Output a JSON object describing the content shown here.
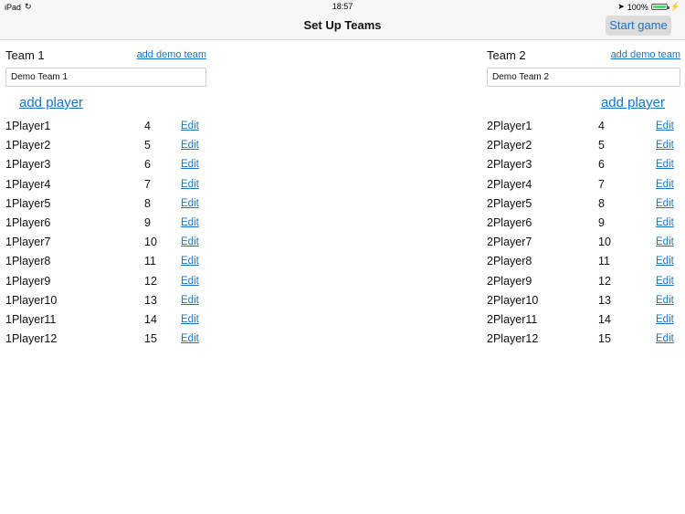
{
  "status": {
    "device": "iPad",
    "time": "18:57",
    "battery": "100%"
  },
  "nav": {
    "title": "Set Up Teams",
    "start_label": "Start game"
  },
  "team1": {
    "label": "Team 1",
    "demo_label": "add demo team",
    "name_value": "Demo Team 1",
    "add_player_label": "add player",
    "players": [
      {
        "name": "1Player1",
        "number": "4",
        "edit": "Edit"
      },
      {
        "name": "1Player2",
        "number": "5",
        "edit": "Edit"
      },
      {
        "name": "1Player3",
        "number": "6",
        "edit": "Edit"
      },
      {
        "name": "1Player4",
        "number": "7",
        "edit": "Edit"
      },
      {
        "name": "1Player5",
        "number": "8",
        "edit": "Edit"
      },
      {
        "name": "1Player6",
        "number": "9",
        "edit": "Edit"
      },
      {
        "name": "1Player7",
        "number": "10",
        "edit": "Edit"
      },
      {
        "name": "1Player8",
        "number": "11",
        "edit": "Edit"
      },
      {
        "name": "1Player9",
        "number": "12",
        "edit": "Edit"
      },
      {
        "name": "1Player10",
        "number": "13",
        "edit": "Edit"
      },
      {
        "name": "1Player11",
        "number": "14",
        "edit": "Edit"
      },
      {
        "name": "1Player12",
        "number": "15",
        "edit": "Edit"
      }
    ]
  },
  "team2": {
    "label": "Team 2",
    "demo_label": "add demo team",
    "name_value": "Demo Team 2",
    "add_player_label": "add player",
    "players": [
      {
        "name": "2Player1",
        "number": "4",
        "edit": "Edit"
      },
      {
        "name": "2Player2",
        "number": "5",
        "edit": "Edit"
      },
      {
        "name": "2Player3",
        "number": "6",
        "edit": "Edit"
      },
      {
        "name": "2Player4",
        "number": "7",
        "edit": "Edit"
      },
      {
        "name": "2Player5",
        "number": "8",
        "edit": "Edit"
      },
      {
        "name": "2Player6",
        "number": "9",
        "edit": "Edit"
      },
      {
        "name": "2Player7",
        "number": "10",
        "edit": "Edit"
      },
      {
        "name": "2Player8",
        "number": "11",
        "edit": "Edit"
      },
      {
        "name": "2Player9",
        "number": "12",
        "edit": "Edit"
      },
      {
        "name": "2Player10",
        "number": "13",
        "edit": "Edit"
      },
      {
        "name": "2Player11",
        "number": "14",
        "edit": "Edit"
      },
      {
        "name": "2Player12",
        "number": "15",
        "edit": "Edit"
      }
    ]
  }
}
